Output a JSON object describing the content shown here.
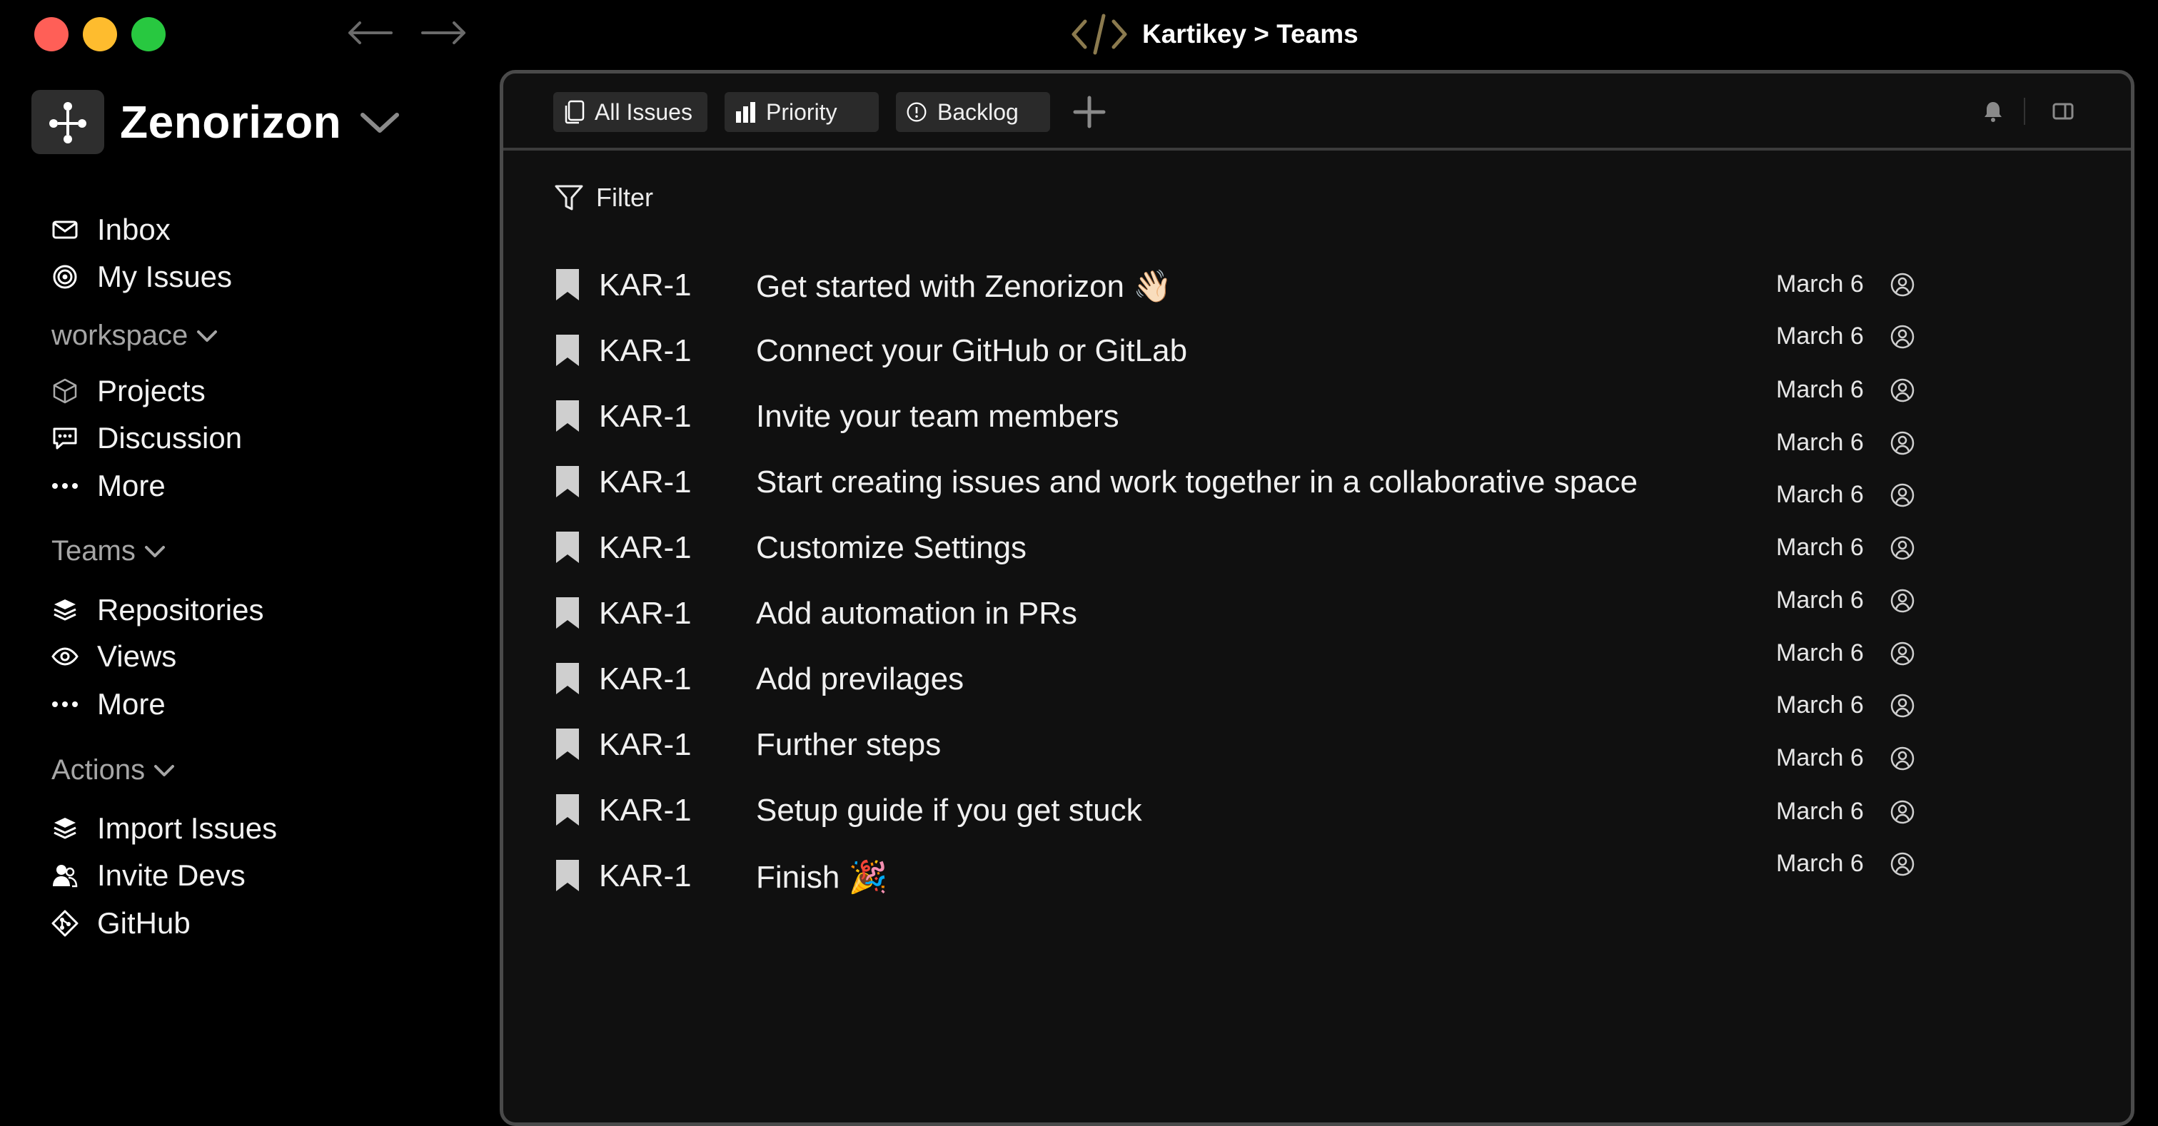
{
  "window": {
    "title": "Kartikey > Teams"
  },
  "sidebar": {
    "workspace_name": "Zenorizon",
    "top_items": [
      {
        "label": "Inbox",
        "icon": "mail-icon"
      },
      {
        "label": "My Issues",
        "icon": "target-icon"
      }
    ],
    "sections": [
      {
        "label": "workspace",
        "items": [
          {
            "label": "Projects",
            "icon": "cube-icon"
          },
          {
            "label": "Discussion",
            "icon": "chat-icon"
          },
          {
            "label": "More",
            "icon": "more-icon"
          }
        ]
      },
      {
        "label": "Teams",
        "items": [
          {
            "label": "Repositories",
            "icon": "layers-icon"
          },
          {
            "label": "Views",
            "icon": "eye-icon"
          },
          {
            "label": "More",
            "icon": "more-icon"
          }
        ]
      },
      {
        "label": "Actions",
        "items": [
          {
            "label": "Import Issues",
            "icon": "layers-icon"
          },
          {
            "label": "Invite Devs",
            "icon": "users-icon"
          },
          {
            "label": "GitHub",
            "icon": "git-icon"
          }
        ]
      }
    ]
  },
  "tabs": [
    {
      "label": "All Issues",
      "icon": "copy-icon"
    },
    {
      "label": "Priority",
      "icon": "bar-chart-icon"
    },
    {
      "label": "Backlog",
      "icon": "alert-circle-icon"
    }
  ],
  "filter_label": "Filter",
  "issues": [
    {
      "id": "KAR-1",
      "title": "Get started with Zenorizon 👋🏻",
      "date": "March 6"
    },
    {
      "id": "KAR-1",
      "title": "Connect your GitHub or GitLab",
      "date": "March 6"
    },
    {
      "id": "KAR-1",
      "title": "Invite your team members",
      "date": "March 6"
    },
    {
      "id": "KAR-1",
      "title": "Start creating issues and work together in a collaborative space",
      "date": "March 6"
    },
    {
      "id": "KAR-1",
      "title": "Customize Settings",
      "date": "March 6"
    },
    {
      "id": "KAR-1",
      "title": "Add automation in PRs",
      "date": "March 6"
    },
    {
      "id": "KAR-1",
      "title": "Add previlages",
      "date": "March 6"
    },
    {
      "id": "KAR-1",
      "title": "Further steps",
      "date": "March 6"
    },
    {
      "id": "KAR-1",
      "title": "Setup guide if you get stuck",
      "date": "March 6"
    },
    {
      "id": "KAR-1",
      "title": "Finish 🎉",
      "date": "March 6"
    }
  ],
  "extra_meta": [
    {
      "date": "March 6"
    },
    {
      "date": "March 6"
    }
  ],
  "colors": {
    "background": "#000000",
    "panel": "#101010",
    "tab": "#2a2a2a",
    "accent_code_icon": "#8b7a4e"
  }
}
